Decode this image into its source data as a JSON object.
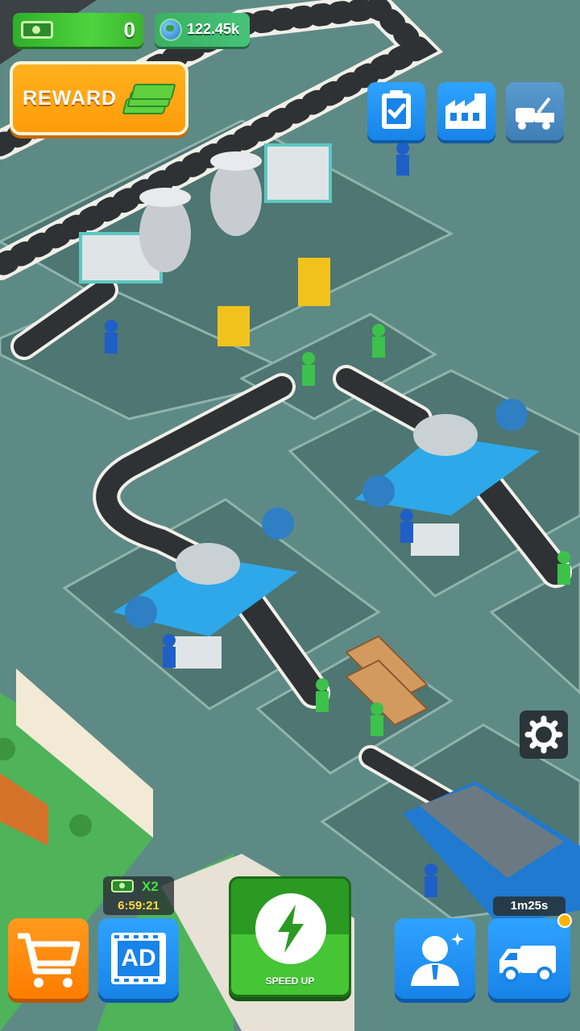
{
  "hud": {
    "cash_value": "0",
    "global_value": "122.45k",
    "reward_label": "REWARD"
  },
  "top_right_buttons": [
    {
      "name": "tasks-button",
      "icon": "clipboard-check-icon"
    },
    {
      "name": "factory-button",
      "icon": "factory-icon"
    },
    {
      "name": "tow-truck-button",
      "icon": "tow-truck-icon"
    }
  ],
  "boost": {
    "multiplier": "X2",
    "time_left": "6:59:21"
  },
  "speed_up": {
    "label": "SPEED UP"
  },
  "delivery": {
    "timer": "1m25s"
  },
  "bottom_buttons": [
    {
      "name": "shop-button",
      "icon": "shopping-cart-icon"
    },
    {
      "name": "ad-button",
      "icon": "ad-film-icon",
      "label": "AD"
    },
    {
      "name": "speed-up-button",
      "icon": "lightning-icon"
    },
    {
      "name": "manager-button",
      "icon": "manager-icon"
    },
    {
      "name": "delivery-truck-button",
      "icon": "delivery-truck-icon"
    }
  ],
  "colors": {
    "floor": "#5e8a86",
    "primary_blue": "#1883e8",
    "orange": "#ff9a1e",
    "green": "#46c535"
  }
}
